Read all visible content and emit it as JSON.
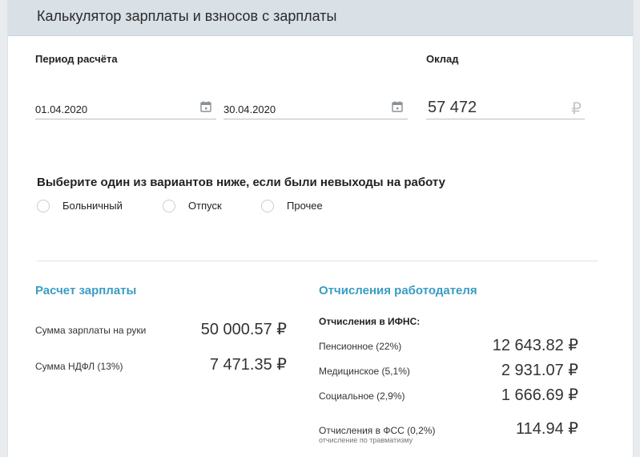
{
  "header": {
    "title": "Калькулятор зарплаты и взносов с зарплаты"
  },
  "period": {
    "label": "Период расчёта",
    "date_from": "01.04.2020",
    "date_to": "30.04.2020"
  },
  "salary": {
    "label": "Оклад",
    "value": "57 472",
    "currency": "₽"
  },
  "absence": {
    "question": "Выберите один из вариантов ниже, если были невыходы на работу",
    "options": [
      "Больничный",
      "Отпуск",
      "Прочее"
    ]
  },
  "calc": {
    "title": "Расчет зарплаты",
    "rows": [
      {
        "label": "Сумма зарплаты на руки",
        "amount": "50 000.57 ₽"
      },
      {
        "label": "Сумма НДФЛ (13%)",
        "amount": "7 471.35 ₽"
      }
    ]
  },
  "employer": {
    "title": "Отчисления работодателя",
    "ifns_label": "Отчисления в ИФНС:",
    "rows": [
      {
        "label": "Пенсионное (22%)",
        "amount": "12 643.82 ₽"
      },
      {
        "label": "Медицинское (5,1%)",
        "amount": "2 931.07 ₽"
      },
      {
        "label": "Социальное (2,9%)",
        "amount": "1 666.69 ₽"
      }
    ],
    "fss": {
      "label": "Отчисления в ФСС (0,2%)",
      "note": "отчисление по травматизму",
      "amount": "114.94 ₽"
    }
  }
}
